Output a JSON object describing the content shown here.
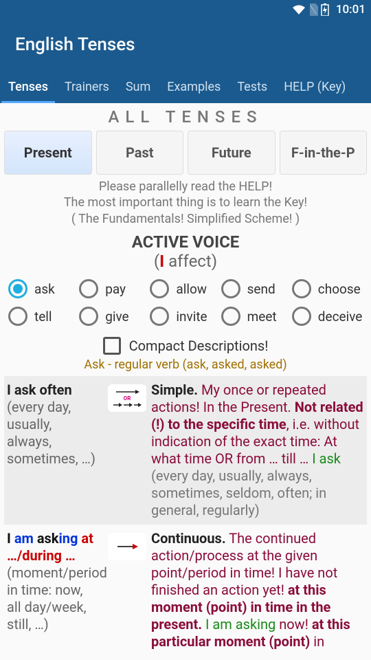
{
  "status": {
    "time": "10:01"
  },
  "app": {
    "title": "English Tenses"
  },
  "tabs": [
    "Tenses",
    "Trainers",
    "Sum",
    "Examples",
    "Tests",
    "HELP (Key)"
  ],
  "active_tab": 0,
  "section_head": "ALL TENSES",
  "chips": [
    "Present",
    "Past",
    "Future",
    "F-in-the-P"
  ],
  "active_chip": 0,
  "help_lines": [
    "Please parallelly read the HELP!",
    "The most important thing is to learn the Key!",
    "( The Fundamentals! Simplified Scheme! )"
  ],
  "voice_head": "ACTIVE VOICE",
  "voice_sub_pre": "(",
  "voice_sub_i": "I",
  "voice_sub_post": " affect)",
  "verbs": [
    "ask",
    "pay",
    "allow",
    "send",
    "choose",
    "tell",
    "give",
    "invite",
    "meet",
    "deceive"
  ],
  "selected_verb": 0,
  "compact_label": "Compact Descriptions!",
  "verb_info": "Ask - regular verb (ask, asked, asked)",
  "rows": {
    "simple": {
      "left_bold": "I ask often",
      "left_gray": " (every day, usually, always, sometimes, …)",
      "right_title": "Simple.",
      "right_body1": " My once or repeated actions! In the Present. ",
      "right_body_bold1": "Not related (!) to the specific time",
      "right_body2": ", i.e. without indication of the exact time: At what time OR from … till … ",
      "right_green": "I ask",
      "right_gray2": " (every day, usually, always, sometimes, seldom, often; in general, regularly)"
    },
    "continuous": {
      "left_html_i": "I ",
      "left_html_am": "am",
      "left_html_ask": " ask",
      "left_html_ing": "ing",
      "left_html_at": " at …/during …",
      "left_gray": " (moment/period in time: now, all day/week, still, …)",
      "right_title": "Continuous.",
      "right_body1": " The continued action/process at the given point/period in time! I have not finished an action yet! ",
      "right_bold1": "at this moment (point) in time in the present.",
      "right_green": " I am asking",
      "right_body2": " now! ",
      "right_bold2": "at this particular moment (point)",
      "right_body3": " in"
    }
  }
}
